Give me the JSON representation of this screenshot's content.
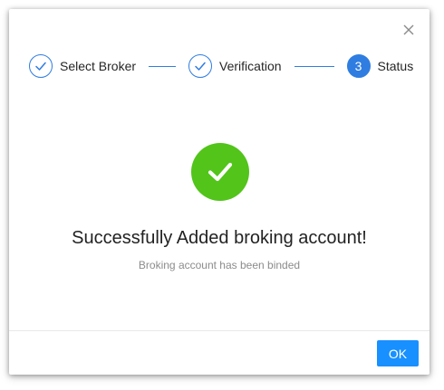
{
  "dialog": {
    "close_icon": "close-icon",
    "steps": [
      {
        "label": "Select Broker",
        "state": "finished",
        "icon": "check-icon"
      },
      {
        "label": "Verification",
        "state": "finished",
        "icon": "check-icon"
      },
      {
        "label": "Status",
        "state": "active",
        "number": "3"
      }
    ],
    "result": {
      "icon": "success-check-icon",
      "title": "Successfully Added broking account!",
      "subtitle": "Broking account has been binded"
    },
    "ok_label": "OK"
  },
  "colors": {
    "accent": "#2f7de1",
    "success": "#52c41a",
    "primary_button": "#1890ff"
  }
}
